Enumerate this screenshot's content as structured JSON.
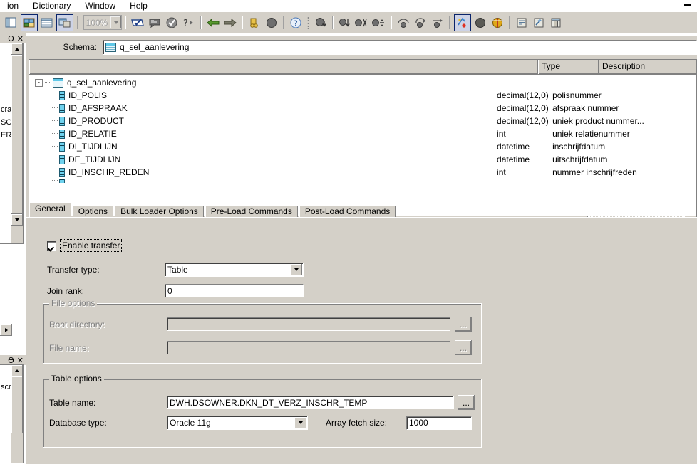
{
  "window": {
    "minimize_glyph": "minimize"
  },
  "menubar": {
    "items": [
      {
        "label": "ion",
        "accel": ""
      },
      {
        "label": "Dictionary",
        "accel": "a"
      },
      {
        "label": "Window",
        "accel": "W"
      },
      {
        "label": "Help",
        "accel": "H"
      }
    ]
  },
  "toolbar": {
    "zoom_value": "100%",
    "buttons": [
      {
        "name": "panel-left-icon",
        "pressed": false
      },
      {
        "name": "diagram-window-icon",
        "pressed": true
      },
      {
        "name": "grid-window-icon",
        "pressed": false
      },
      {
        "name": "transform-window-icon",
        "pressed": true
      },
      {
        "name": "check-mark-box-icon",
        "pressed": false
      },
      {
        "name": "note-icon",
        "pressed": false
      },
      {
        "name": "validate-icon",
        "pressed": false
      },
      {
        "name": "help-arrow-icon",
        "pressed": false
      },
      {
        "name": "back-arrow-icon",
        "pressed": false
      },
      {
        "name": "forward-arrow-icon",
        "pressed": false
      },
      {
        "name": "coins-icon",
        "pressed": false
      },
      {
        "name": "sphere-icon",
        "pressed": false
      },
      {
        "name": "question-help-icon",
        "pressed": false
      },
      {
        "name": "sphere-down-icon",
        "pressed": false
      },
      {
        "name": "sphere-arrow-down-icon",
        "pressed": false
      },
      {
        "name": "sphere-split-icon",
        "pressed": false
      },
      {
        "name": "sphere-divide-icon",
        "pressed": false
      },
      {
        "name": "arc-link-icon",
        "pressed": false
      },
      {
        "name": "arc-link-2-icon",
        "pressed": false
      },
      {
        "name": "arc-link-3-icon",
        "pressed": false
      },
      {
        "name": "run-job-icon",
        "pressed": true
      },
      {
        "name": "dark-sphere-icon",
        "pressed": false
      },
      {
        "name": "gold-package-icon",
        "pressed": false
      },
      {
        "name": "report-icon",
        "pressed": false
      },
      {
        "name": "script-wand-icon",
        "pressed": false
      },
      {
        "name": "window-layout-icon",
        "pressed": false
      }
    ]
  },
  "left_panels": {
    "pane1": {
      "pin_glyph": "Ө",
      "close_glyph": "✕",
      "text_fragments": [
        "cra",
        "SO\\V",
        "ER)"
      ]
    },
    "pane2": {
      "pin_glyph": "Ө",
      "close_glyph": "✕",
      "text_fragments": [
        "scri"
      ]
    }
  },
  "schema": {
    "label": "Schema:",
    "value": "q_sel_aanlevering"
  },
  "grid": {
    "columns": [
      "",
      "Type",
      "Description"
    ],
    "root": {
      "label": "q_sel_aanlevering",
      "expander": "-",
      "type": "",
      "description": ""
    },
    "rows": [
      {
        "label": "ID_POLIS",
        "type": "decimal(12,0)",
        "description": "polisnummer"
      },
      {
        "label": "ID_AFSPRAAK",
        "type": "decimal(12,0)",
        "description": "afspraak nummer"
      },
      {
        "label": "ID_PRODUCT",
        "type": "decimal(12,0)",
        "description": "uniek product nummer..."
      },
      {
        "label": "ID_RELATIE",
        "type": "int",
        "description": "uniek relatienummer"
      },
      {
        "label": "DI_TIJDLIJN",
        "type": "datetime",
        "description": "inschrijfdatum"
      },
      {
        "label": "DE_TIJDLIJN",
        "type": "datetime",
        "description": "uitschrijfdatum"
      },
      {
        "label": "ID_INSCHR_REDEN",
        "type": "int",
        "description": "nummer inschrijfreden"
      }
    ]
  },
  "tabs": [
    {
      "label": "General",
      "active": true
    },
    {
      "label": "Options",
      "active": false
    },
    {
      "label": "Bulk Loader Options",
      "active": false
    },
    {
      "label": "Pre-Load Commands",
      "active": false
    },
    {
      "label": "Post-Load Commands",
      "active": false
    }
  ],
  "general_tab": {
    "enable_transfer": {
      "label": "Enable transfer",
      "checked": true
    },
    "transfer_type": {
      "label": "Transfer type:",
      "value": "Table"
    },
    "join_rank": {
      "label": "Join rank:",
      "value": "0"
    },
    "file_options": {
      "title": "File options",
      "enabled": false,
      "root_directory": {
        "label": "Root directory:",
        "value": "",
        "browse": "..."
      },
      "file_name": {
        "label": "File name:",
        "value": "",
        "browse": "..."
      }
    },
    "table_options": {
      "title": "Table options",
      "table_name": {
        "label": "Table name:",
        "value": "DWH.DSOWNER.DKN_DT_VERZ_INSCHR_TEMP",
        "browse": "..."
      },
      "database_type": {
        "label": "Database type:",
        "value": "Oracle 11g"
      },
      "array_fetch_size": {
        "label": "Array fetch size:",
        "value": "1000"
      }
    }
  },
  "colors": {
    "window_face": "#d4d0c8",
    "field_bg": "#ffffff",
    "border_dark": "#808080",
    "pressed_border": "#0a246a",
    "pressed_fill": "#cdd3e6",
    "disabled_text": "#808080",
    "icon_cyan": "#6fd2ee"
  }
}
